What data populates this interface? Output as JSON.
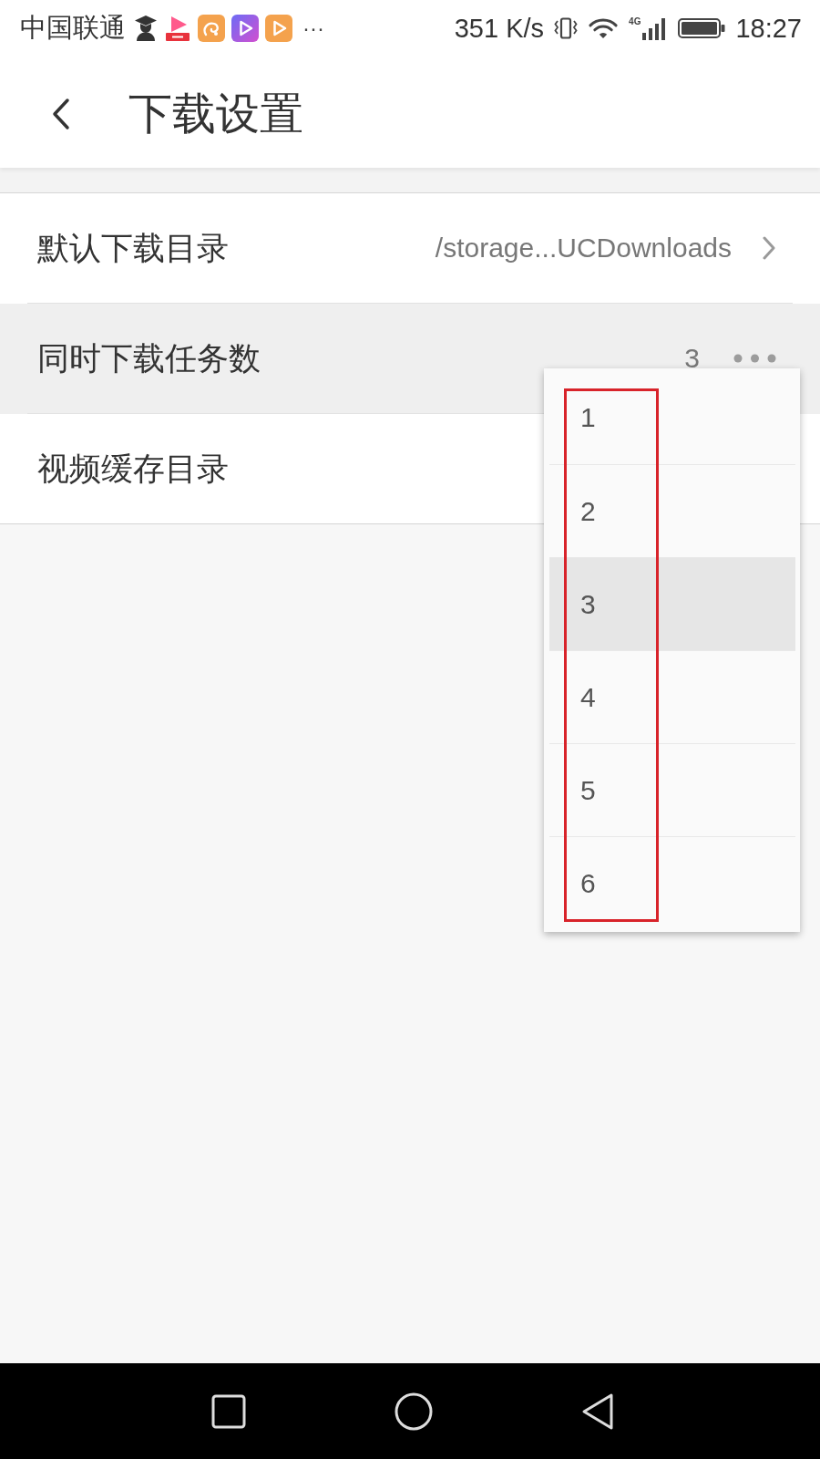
{
  "status_bar": {
    "carrier": "中国联通",
    "overflow": "···",
    "speed": "351 K/s",
    "network": "4G",
    "time": "18:27"
  },
  "header": {
    "title": "下载设置"
  },
  "settings": [
    {
      "kind": "link",
      "label": "默认下载目录",
      "value": "/storage...UCDownloads",
      "selected": false
    },
    {
      "kind": "menu",
      "label": "同时下载任务数",
      "value": "3",
      "selected": true
    },
    {
      "kind": "plain",
      "label": "视频缓存目录",
      "selected": false
    }
  ],
  "dropdown": {
    "framed": true,
    "options": [
      {
        "label": "1",
        "selected": false
      },
      {
        "label": "2",
        "selected": false
      },
      {
        "label": "3",
        "selected": true
      },
      {
        "label": "4",
        "selected": false
      },
      {
        "label": "5",
        "selected": false
      },
      {
        "label": "6",
        "selected": false
      }
    ]
  }
}
